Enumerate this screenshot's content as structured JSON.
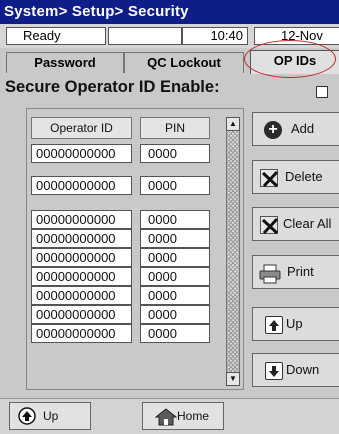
{
  "title": "System> Setup> Security",
  "status": {
    "state": "Ready",
    "blank": "",
    "time": "10:40",
    "date": "12-Nov"
  },
  "tabs": {
    "password": "Password",
    "qc_lockout": "QC Lockout",
    "op_ids": "OP IDs",
    "active": "OP IDs"
  },
  "heading": "Secure Operator ID Enable:",
  "secure_enable_checked": false,
  "table": {
    "headers": {
      "operator_id": "Operator ID",
      "pin": "PIN"
    },
    "rows": [
      {
        "id": "00000000000",
        "pin": "0000"
      },
      {
        "id": "00000000000",
        "pin": "0000"
      },
      {
        "id": "00000000000",
        "pin": "0000"
      },
      {
        "id": "00000000000",
        "pin": "0000"
      },
      {
        "id": "00000000000",
        "pin": "0000"
      },
      {
        "id": "00000000000",
        "pin": "0000"
      },
      {
        "id": "00000000000",
        "pin": "0000"
      },
      {
        "id": "00000000000",
        "pin": "0000"
      },
      {
        "id": "00000000000",
        "pin": "0000"
      }
    ]
  },
  "actions": {
    "add": "Add",
    "delete": "Delete",
    "clear_all": "Clear All",
    "print": "Print",
    "up": "Up",
    "down": "Down"
  },
  "nav": {
    "up": "Up",
    "home": "Home"
  },
  "icons": {
    "add": "plus-circle-icon",
    "delete": "x-mark-icon",
    "clear_all": "x-mark-icon",
    "print": "printer-icon",
    "up": "page-up-icon",
    "down": "page-down-icon",
    "nav_up": "arrow-up-circle-icon",
    "nav_home": "home-icon"
  },
  "colors": {
    "title_bar": "#0f1d88",
    "highlight_oval": "#c0282a",
    "panel": "#c9c9c9"
  }
}
